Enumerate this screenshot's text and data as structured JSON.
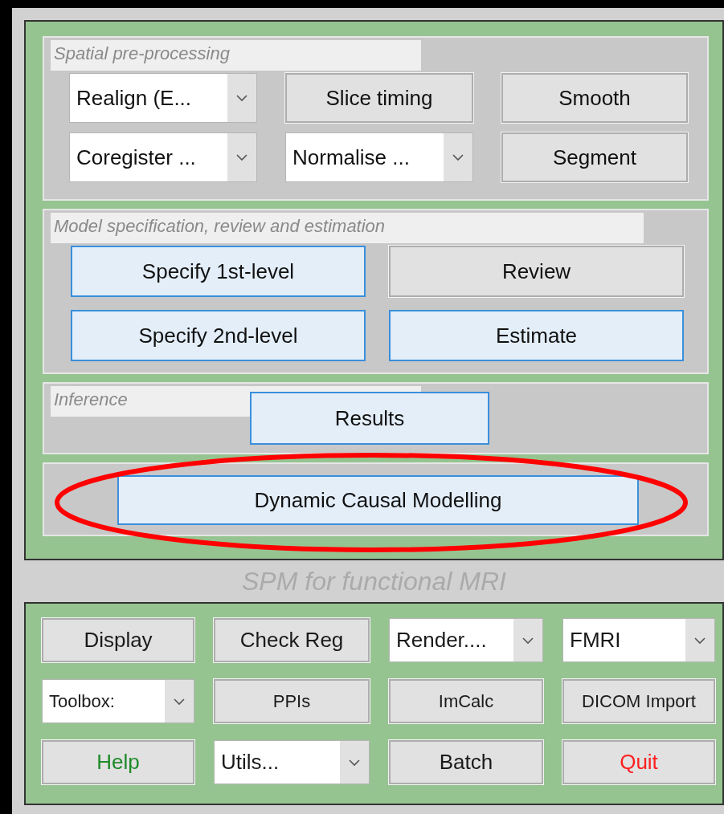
{
  "sections": [
    {
      "label": "Spatial pre-processing",
      "kind": "grid3",
      "controls": [
        {
          "kind": "dropdown",
          "value": "Realign (E..."
        },
        {
          "kind": "button",
          "label": "Slice timing",
          "highlighted": false
        },
        {
          "kind": "button",
          "label": "Smooth",
          "highlighted": false
        },
        {
          "kind": "dropdown",
          "value": "Coregister ..."
        },
        {
          "kind": "dropdown",
          "value": "Normalise ..."
        },
        {
          "kind": "button",
          "label": "Segment",
          "highlighted": false
        }
      ]
    },
    {
      "label": "Model specification, review and estimation",
      "kind": "grid2",
      "controls": [
        {
          "kind": "button",
          "label": "Specify 1st-level",
          "highlighted": true
        },
        {
          "kind": "button",
          "label": "Review",
          "highlighted": false
        },
        {
          "kind": "button",
          "label": "Specify 2nd-level",
          "highlighted": true
        },
        {
          "kind": "button",
          "label": "Estimate",
          "highlighted": true
        }
      ]
    },
    {
      "label": "Inference",
      "kind": "results",
      "controls": [
        {
          "kind": "button",
          "label": "Results",
          "highlighted": true
        }
      ]
    },
    {
      "kind": "wide",
      "controls": [
        {
          "kind": "button",
          "label": "Dynamic Causal Modelling",
          "highlighted": true
        }
      ]
    }
  ],
  "annotation": {
    "kind": "ellipse",
    "color": "#ff0000"
  },
  "subtitle": "SPM for functional MRI",
  "tools": [
    {
      "kind": "button",
      "label": "Display",
      "color": "#1a1a1a"
    },
    {
      "kind": "button",
      "label": "Check Reg",
      "color": "#1a1a1a"
    },
    {
      "kind": "dropdown",
      "value": "Render....",
      "color": "#1a1a1a"
    },
    {
      "kind": "dropdown",
      "value": "FMRI",
      "color": "#1a1a1a"
    },
    {
      "kind": "dropdown",
      "value": "Toolbox:",
      "color": "#1a1a1a",
      "small": true
    },
    {
      "kind": "button",
      "label": "PPIs",
      "color": "#1a1a1a",
      "small": true
    },
    {
      "kind": "button",
      "label": "ImCalc",
      "color": "#1a1a1a",
      "small": true
    },
    {
      "kind": "button",
      "label": "DICOM Import",
      "color": "#1a1a1a",
      "small": true
    },
    {
      "kind": "button",
      "label": "Help",
      "color": "#1e8a2a"
    },
    {
      "kind": "dropdown",
      "value": "Utils...",
      "color": "#1a1a1a"
    },
    {
      "kind": "button",
      "label": "Batch",
      "color": "#1a1a1a"
    },
    {
      "kind": "button",
      "label": "Quit",
      "color": "#ff2020"
    }
  ]
}
